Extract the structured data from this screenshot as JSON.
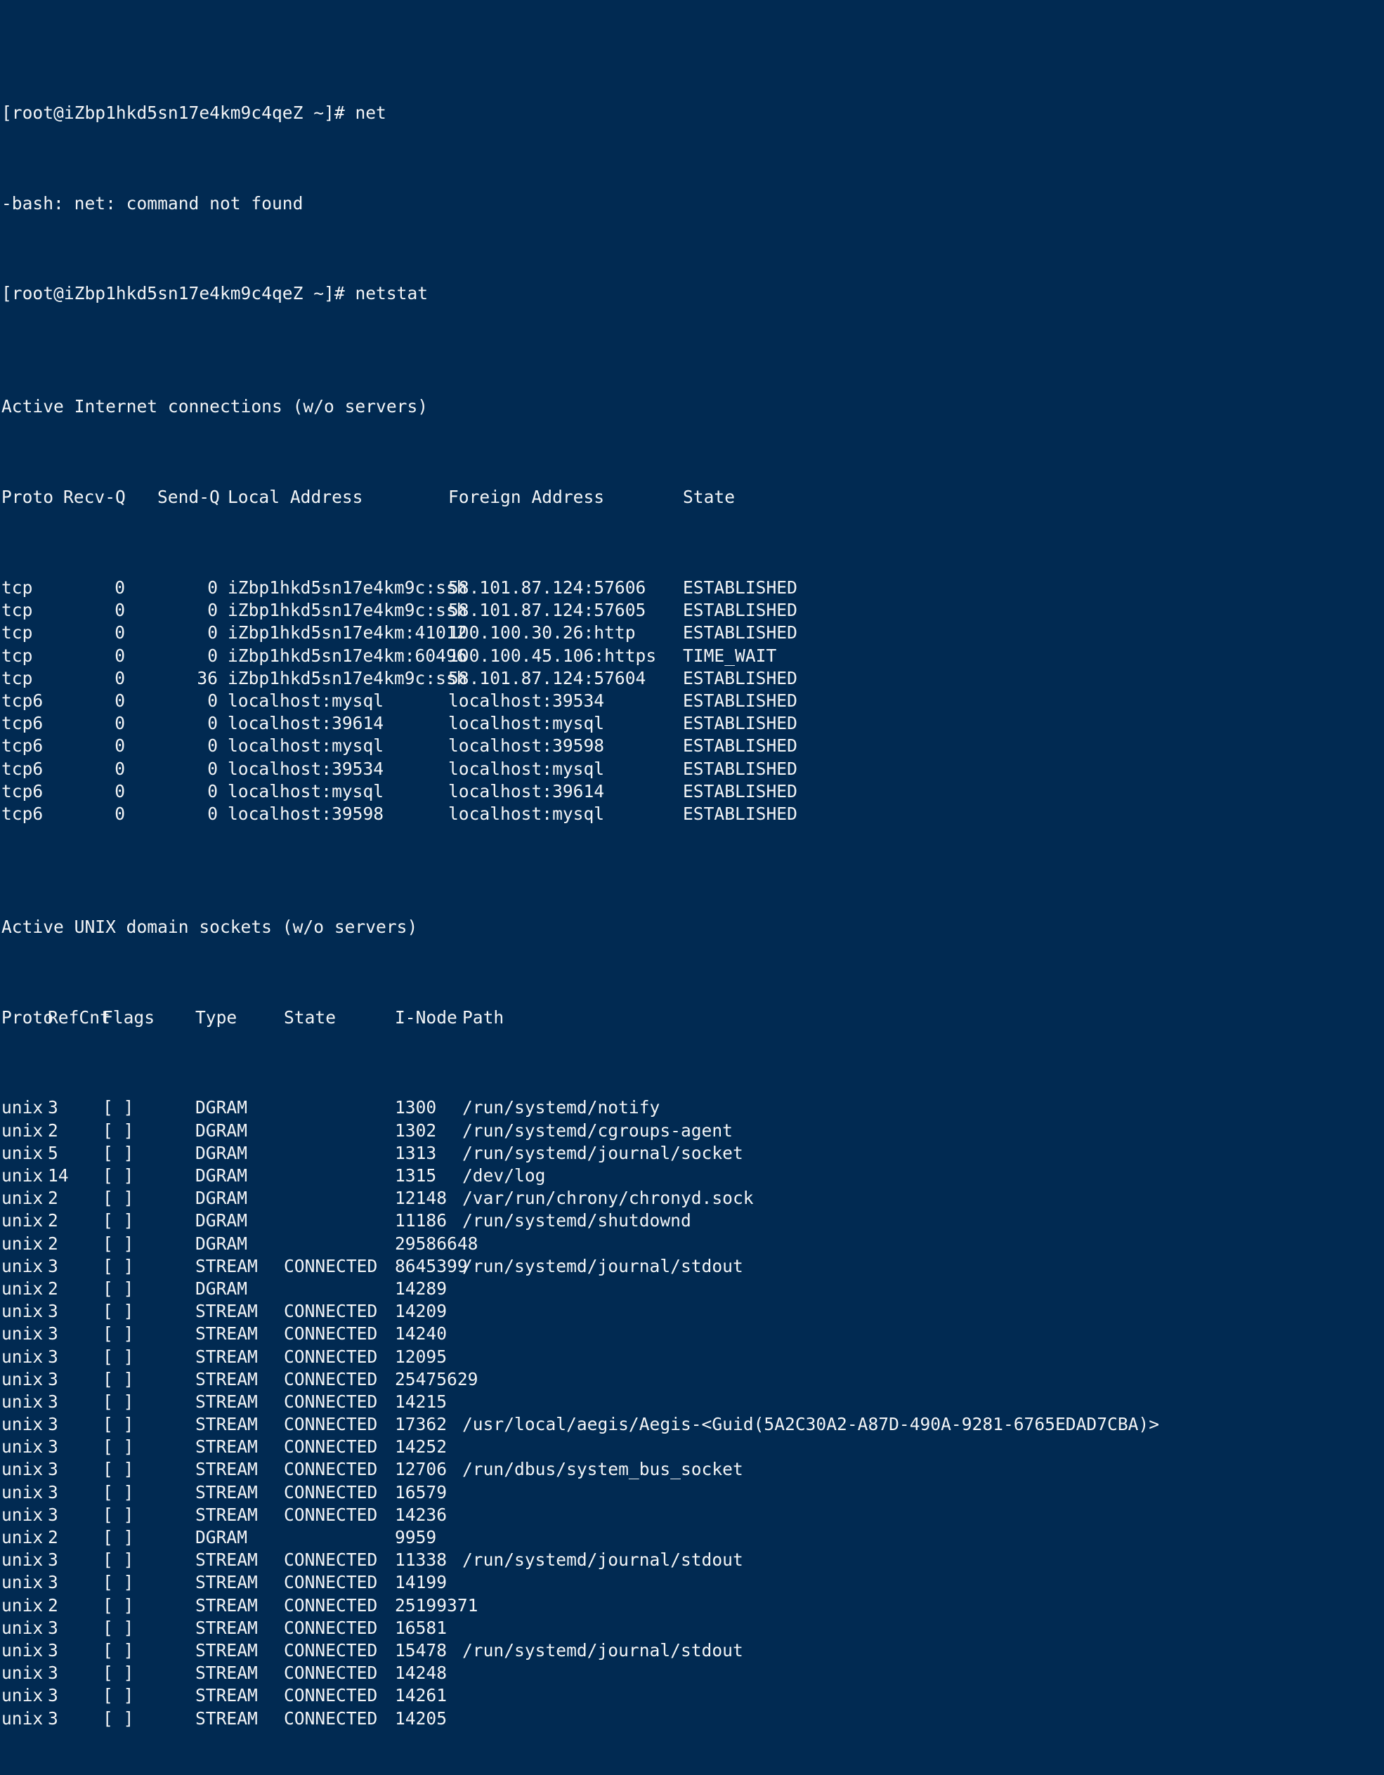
{
  "terminal": {
    "colors": {
      "background": "#012a52",
      "foreground": "#f2f4f6"
    },
    "prompt": "[root@iZbp1hkd5sn17e4km9c4qeZ ~]#",
    "history": [
      {
        "prompt": "[root@iZbp1hkd5sn17e4km9c4qeZ ~]#",
        "command": "net"
      },
      {
        "error": "-bash: net: command not found"
      },
      {
        "prompt": "[root@iZbp1hkd5sn17e4km9c4qeZ ~]#",
        "command": "netstat"
      }
    ],
    "internet": {
      "title": "Active Internet connections (w/o servers)",
      "headers": {
        "proto": "Proto",
        "recvq": "Recv-Q",
        "sendq": "Send-Q",
        "local": "Local Address",
        "foreign": "Foreign Address",
        "state": "State"
      },
      "rows": [
        {
          "proto": "tcp",
          "recvq": "0",
          "sendq": "0",
          "local": "iZbp1hkd5sn17e4km9c:ssh",
          "foreign": "58.101.87.124:57606",
          "state": "ESTABLISHED"
        },
        {
          "proto": "tcp",
          "recvq": "0",
          "sendq": "0",
          "local": "iZbp1hkd5sn17e4km9c:ssh",
          "foreign": "58.101.87.124:57605",
          "state": "ESTABLISHED"
        },
        {
          "proto": "tcp",
          "recvq": "0",
          "sendq": "0",
          "local": "iZbp1hkd5sn17e4km:41012",
          "foreign": "100.100.30.26:http",
          "state": "ESTABLISHED"
        },
        {
          "proto": "tcp",
          "recvq": "0",
          "sendq": "0",
          "local": "iZbp1hkd5sn17e4km:60496",
          "foreign": "100.100.45.106:https",
          "state": "TIME_WAIT"
        },
        {
          "proto": "tcp",
          "recvq": "0",
          "sendq": "36",
          "local": "iZbp1hkd5sn17e4km9c:ssh",
          "foreign": "58.101.87.124:57604",
          "state": "ESTABLISHED"
        },
        {
          "proto": "tcp6",
          "recvq": "0",
          "sendq": "0",
          "local": "localhost:mysql",
          "foreign": "localhost:39534",
          "state": "ESTABLISHED"
        },
        {
          "proto": "tcp6",
          "recvq": "0",
          "sendq": "0",
          "local": "localhost:39614",
          "foreign": "localhost:mysql",
          "state": "ESTABLISHED"
        },
        {
          "proto": "tcp6",
          "recvq": "0",
          "sendq": "0",
          "local": "localhost:mysql",
          "foreign": "localhost:39598",
          "state": "ESTABLISHED"
        },
        {
          "proto": "tcp6",
          "recvq": "0",
          "sendq": "0",
          "local": "localhost:39534",
          "foreign": "localhost:mysql",
          "state": "ESTABLISHED"
        },
        {
          "proto": "tcp6",
          "recvq": "0",
          "sendq": "0",
          "local": "localhost:mysql",
          "foreign": "localhost:39614",
          "state": "ESTABLISHED"
        },
        {
          "proto": "tcp6",
          "recvq": "0",
          "sendq": "0",
          "local": "localhost:39598",
          "foreign": "localhost:mysql",
          "state": "ESTABLISHED"
        }
      ]
    },
    "unix": {
      "title": "Active UNIX domain sockets (w/o servers)",
      "headers": {
        "proto": "Proto",
        "refcnt": "RefCnt",
        "flags": "Flags",
        "type": "Type",
        "state": "State",
        "inode": "I-Node",
        "path": "Path"
      },
      "rows": [
        {
          "proto": "unix",
          "refcnt": "3",
          "flags": "[ ]",
          "type": "DGRAM",
          "state": "",
          "inode": "1300",
          "path": "/run/systemd/notify"
        },
        {
          "proto": "unix",
          "refcnt": "2",
          "flags": "[ ]",
          "type": "DGRAM",
          "state": "",
          "inode": "1302",
          "path": "/run/systemd/cgroups-agent"
        },
        {
          "proto": "unix",
          "refcnt": "5",
          "flags": "[ ]",
          "type": "DGRAM",
          "state": "",
          "inode": "1313",
          "path": "/run/systemd/journal/socket"
        },
        {
          "proto": "unix",
          "refcnt": "14",
          "flags": "[ ]",
          "type": "DGRAM",
          "state": "",
          "inode": "1315",
          "path": "/dev/log"
        },
        {
          "proto": "unix",
          "refcnt": "2",
          "flags": "[ ]",
          "type": "DGRAM",
          "state": "",
          "inode": "12148",
          "path": "/var/run/chrony/chronyd.sock"
        },
        {
          "proto": "unix",
          "refcnt": "2",
          "flags": "[ ]",
          "type": "DGRAM",
          "state": "",
          "inode": "11186",
          "path": "/run/systemd/shutdownd"
        },
        {
          "proto": "unix",
          "refcnt": "2",
          "flags": "[ ]",
          "type": "DGRAM",
          "state": "",
          "inode": "29586648",
          "path": ""
        },
        {
          "proto": "unix",
          "refcnt": "3",
          "flags": "[ ]",
          "type": "STREAM",
          "state": "CONNECTED",
          "inode": "8645399",
          "path": "/run/systemd/journal/stdout"
        },
        {
          "proto": "unix",
          "refcnt": "2",
          "flags": "[ ]",
          "type": "DGRAM",
          "state": "",
          "inode": "14289",
          "path": ""
        },
        {
          "proto": "unix",
          "refcnt": "3",
          "flags": "[ ]",
          "type": "STREAM",
          "state": "CONNECTED",
          "inode": "14209",
          "path": ""
        },
        {
          "proto": "unix",
          "refcnt": "3",
          "flags": "[ ]",
          "type": "STREAM",
          "state": "CONNECTED",
          "inode": "14240",
          "path": ""
        },
        {
          "proto": "unix",
          "refcnt": "3",
          "flags": "[ ]",
          "type": "STREAM",
          "state": "CONNECTED",
          "inode": "12095",
          "path": ""
        },
        {
          "proto": "unix",
          "refcnt": "3",
          "flags": "[ ]",
          "type": "STREAM",
          "state": "CONNECTED",
          "inode": "25475629",
          "path": ""
        },
        {
          "proto": "unix",
          "refcnt": "3",
          "flags": "[ ]",
          "type": "STREAM",
          "state": "CONNECTED",
          "inode": "14215",
          "path": ""
        },
        {
          "proto": "unix",
          "refcnt": "3",
          "flags": "[ ]",
          "type": "STREAM",
          "state": "CONNECTED",
          "inode": "17362",
          "path": "/usr/local/aegis/Aegis-<Guid(5A2C30A2-A87D-490A-9281-6765EDAD7CBA)>"
        },
        {
          "proto": "unix",
          "refcnt": "3",
          "flags": "[ ]",
          "type": "STREAM",
          "state": "CONNECTED",
          "inode": "14252",
          "path": ""
        },
        {
          "proto": "unix",
          "refcnt": "3",
          "flags": "[ ]",
          "type": "STREAM",
          "state": "CONNECTED",
          "inode": "12706",
          "path": "/run/dbus/system_bus_socket"
        },
        {
          "proto": "unix",
          "refcnt": "3",
          "flags": "[ ]",
          "type": "STREAM",
          "state": "CONNECTED",
          "inode": "16579",
          "path": ""
        },
        {
          "proto": "unix",
          "refcnt": "3",
          "flags": "[ ]",
          "type": "STREAM",
          "state": "CONNECTED",
          "inode": "14236",
          "path": ""
        },
        {
          "proto": "unix",
          "refcnt": "2",
          "flags": "[ ]",
          "type": "DGRAM",
          "state": "",
          "inode": "9959",
          "path": ""
        },
        {
          "proto": "unix",
          "refcnt": "3",
          "flags": "[ ]",
          "type": "STREAM",
          "state": "CONNECTED",
          "inode": "11338",
          "path": "/run/systemd/journal/stdout"
        },
        {
          "proto": "unix",
          "refcnt": "3",
          "flags": "[ ]",
          "type": "STREAM",
          "state": "CONNECTED",
          "inode": "14199",
          "path": ""
        },
        {
          "proto": "unix",
          "refcnt": "2",
          "flags": "[ ]",
          "type": "STREAM",
          "state": "CONNECTED",
          "inode": "25199371",
          "path": ""
        },
        {
          "proto": "unix",
          "refcnt": "3",
          "flags": "[ ]",
          "type": "STREAM",
          "state": "CONNECTED",
          "inode": "16581",
          "path": ""
        },
        {
          "proto": "unix",
          "refcnt": "3",
          "flags": "[ ]",
          "type": "STREAM",
          "state": "CONNECTED",
          "inode": "15478",
          "path": "/run/systemd/journal/stdout"
        },
        {
          "proto": "unix",
          "refcnt": "3",
          "flags": "[ ]",
          "type": "STREAM",
          "state": "CONNECTED",
          "inode": "14248",
          "path": ""
        },
        {
          "proto": "unix",
          "refcnt": "3",
          "flags": "[ ]",
          "type": "STREAM",
          "state": "CONNECTED",
          "inode": "14261",
          "path": ""
        },
        {
          "proto": "unix",
          "refcnt": "3",
          "flags": "[ ]",
          "type": "STREAM",
          "state": "CONNECTED",
          "inode": "14205",
          "path": ""
        }
      ]
    }
  }
}
